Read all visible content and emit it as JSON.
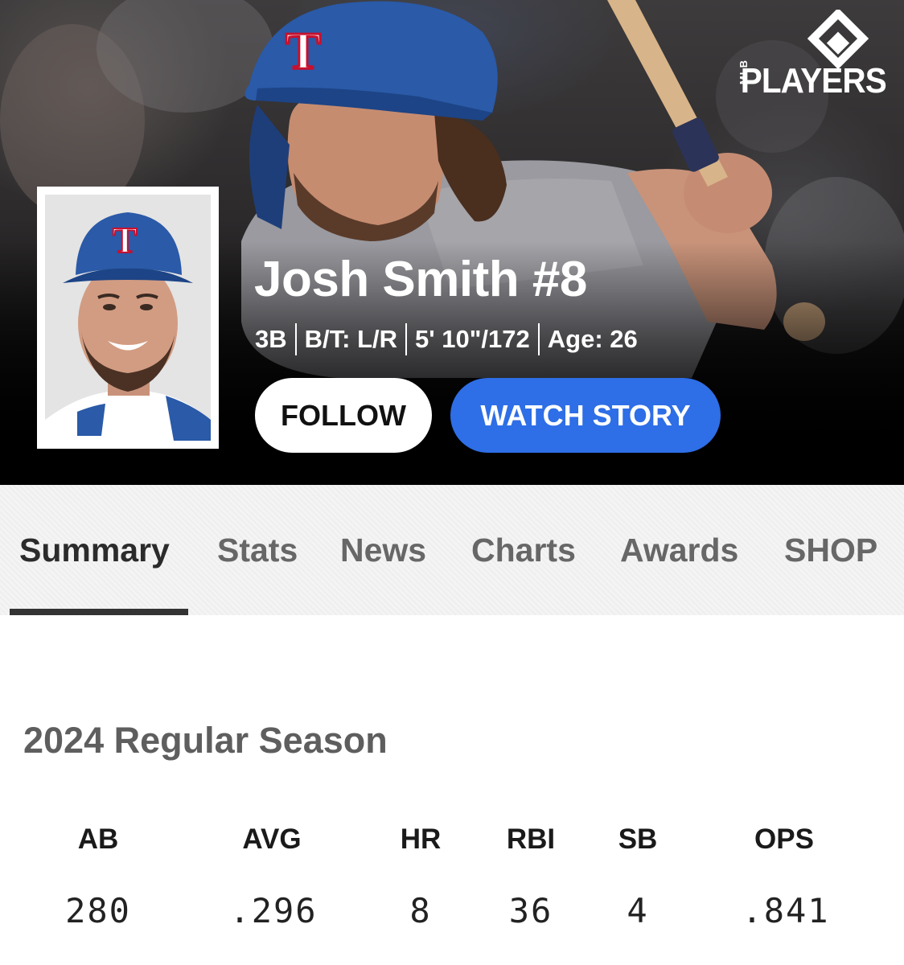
{
  "brand": {
    "name": "PLAYERS",
    "prefix": "MLB",
    "logo_icon": "mlb-players-diamond-logo"
  },
  "player": {
    "name_line": "Josh Smith #8",
    "bio": {
      "position": "3B",
      "bats_throws": "B/T: L/R",
      "height_weight": "5' 10\"/172",
      "age": "Age: 26"
    },
    "cap_letter": "T"
  },
  "actions": {
    "follow_label": "FOLLOW",
    "watch_label": "WATCH STORY"
  },
  "tabs": [
    {
      "label": "Summary",
      "active": true
    },
    {
      "label": "Stats",
      "active": false
    },
    {
      "label": "News",
      "active": false
    },
    {
      "label": "Charts",
      "active": false
    },
    {
      "label": "Awards",
      "active": false
    },
    {
      "label": "SHOP",
      "active": false
    }
  ],
  "season": {
    "title": "2024 Regular Season",
    "stats": [
      {
        "label": "AB",
        "value": "280"
      },
      {
        "label": "AVG",
        "value": ".296"
      },
      {
        "label": "HR",
        "value": "8"
      },
      {
        "label": "RBI",
        "value": "36"
      },
      {
        "label": "SB",
        "value": "4"
      },
      {
        "label": "OPS",
        "value": ".841"
      }
    ]
  },
  "colors": {
    "accent_blue": "#2e6ee6",
    "cap_blue": "#2a5aa8",
    "cap_red": "#c8102e",
    "active_tab": "#2b2b2b",
    "inactive_tab": "#676767"
  }
}
